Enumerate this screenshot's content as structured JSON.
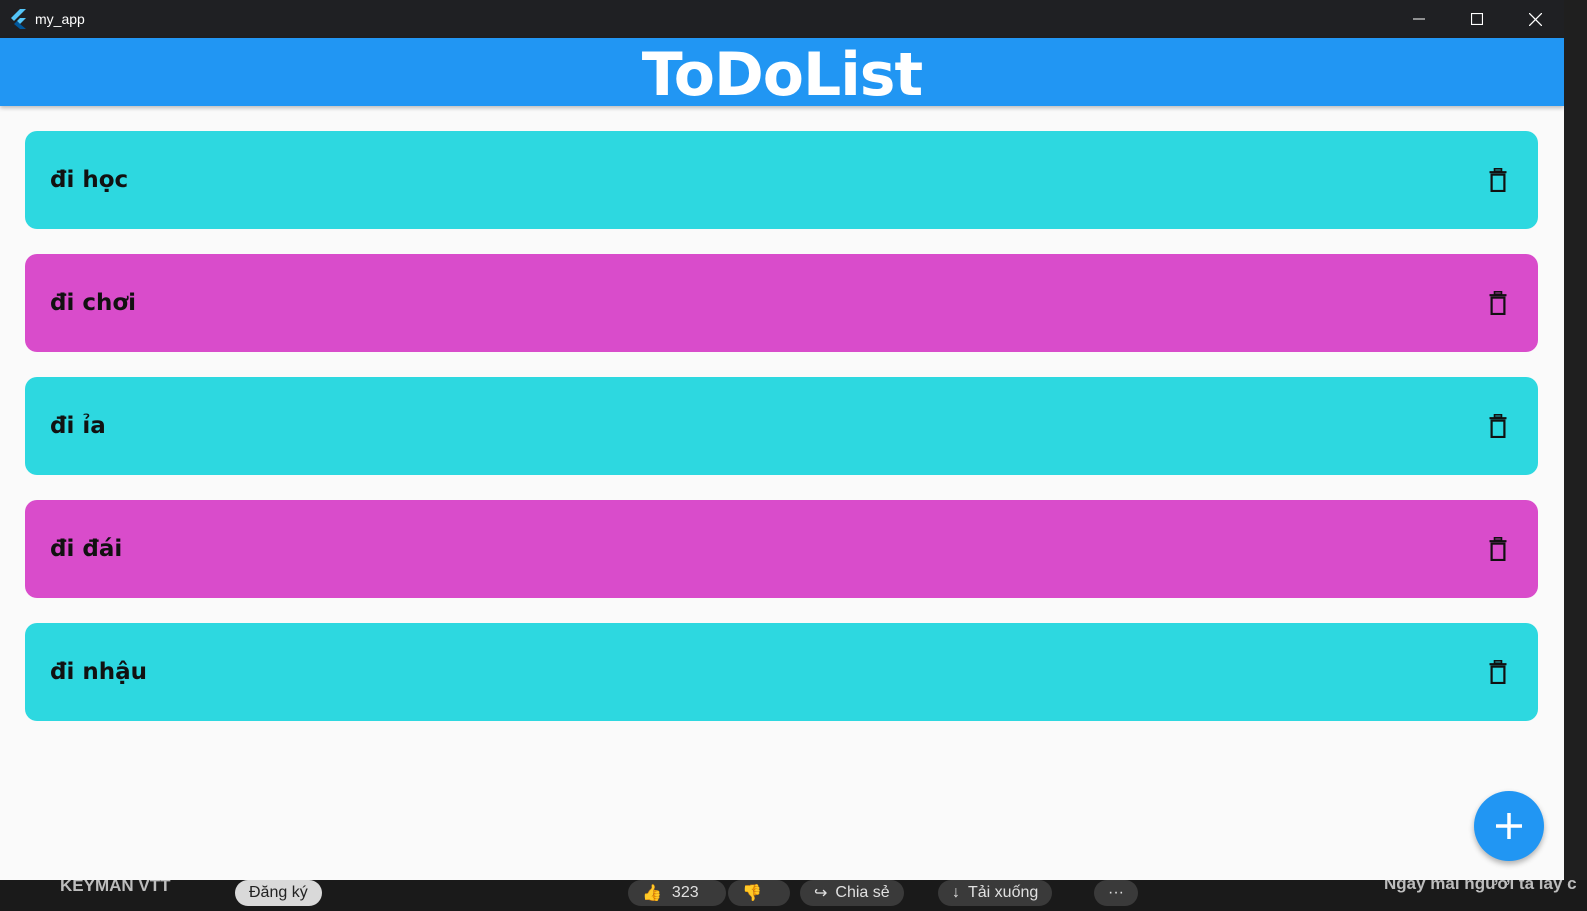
{
  "window": {
    "title": "my_app"
  },
  "appbar": {
    "title": "ToDoList"
  },
  "colors": {
    "titlebar": "#1f2023",
    "appbar": "#2196f3",
    "cyan_item": "#2dd8e0",
    "magenta_item": "#d94ccb",
    "fab": "#2196f3"
  },
  "todos": [
    {
      "text": "đi học",
      "color": "#2dd8e0"
    },
    {
      "text": "đi chơi",
      "color": "#d94ccb"
    },
    {
      "text": "đi ỉa",
      "color": "#2dd8e0"
    },
    {
      "text": "đi đái",
      "color": "#d94ccb"
    },
    {
      "text": "đi nhậu",
      "color": "#2dd8e0"
    }
  ],
  "fab": {
    "icon": "plus-icon"
  },
  "background_video": {
    "channel": "KEYMAN VTT",
    "subscribe": "Đăng ký",
    "likes": "323",
    "share": "Chia sẻ",
    "download": "Tải xuống",
    "more": "···",
    "side_title": "Ngày mai người ta lấy c"
  }
}
